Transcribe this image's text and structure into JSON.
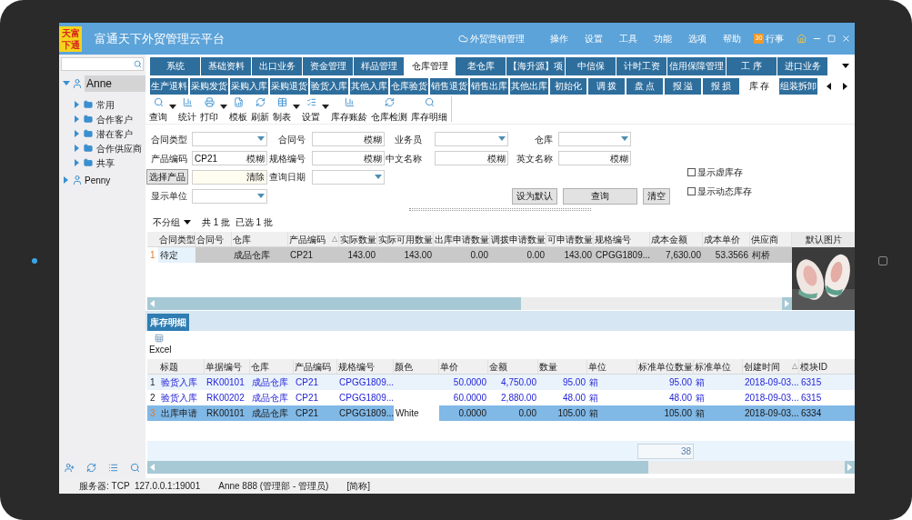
{
  "app": {
    "logo": [
      "天富",
      "下通"
    ],
    "title": "富通天下外贸管理云平台",
    "cloud_link": "外贸营销管理",
    "menu": [
      "操作",
      "设置",
      "工具",
      "功能",
      "选项",
      "帮助"
    ],
    "calendar": {
      "badge": "30",
      "label": "行事"
    }
  },
  "sidebar": {
    "tree": [
      {
        "label": "Anne",
        "expanded": true,
        "selected": true,
        "children": [
          {
            "label": "常用",
            "expanded": false
          },
          {
            "label": "合作客户",
            "expanded": false
          },
          {
            "label": "潜在客户",
            "expanded": false
          },
          {
            "label": "合作供应商",
            "expanded": false
          },
          {
            "label": "共享",
            "expanded": false
          }
        ]
      },
      {
        "label": "Penny",
        "expanded": false,
        "selected": false
      }
    ]
  },
  "module_tabs": [
    {
      "label": "系统",
      "selected": false
    },
    {
      "label": "基础资料",
      "selected": false
    },
    {
      "label": "出口业务",
      "selected": false
    },
    {
      "label": "资金管理",
      "selected": false
    },
    {
      "label": "样品管理",
      "selected": false
    },
    {
      "label": "仓库管理",
      "selected": true
    },
    {
      "label": "老仓库",
      "selected": false
    },
    {
      "label": "【海升源】项",
      "selected": false
    },
    {
      "label": "中信保",
      "selected": false
    },
    {
      "label": "计时工资",
      "selected": false
    },
    {
      "label": "信用保障管理",
      "selected": false
    },
    {
      "label": "工 序",
      "selected": false
    },
    {
      "label": "进口业务",
      "selected": false
    }
  ],
  "sub_tabs": [
    {
      "label": "生产退料",
      "selected": false
    },
    {
      "label": "采购发货",
      "selected": false
    },
    {
      "label": "采购入库",
      "selected": false
    },
    {
      "label": "采购退货",
      "selected": false
    },
    {
      "label": "验货入库",
      "selected": false
    },
    {
      "label": "其他入库",
      "selected": false
    },
    {
      "label": "仓库验货",
      "selected": false
    },
    {
      "label": "销售退货",
      "selected": false
    },
    {
      "label": "销售出库",
      "selected": false
    },
    {
      "label": "其他出库",
      "selected": false
    },
    {
      "label": "初始化",
      "selected": false
    },
    {
      "label": "调 拨",
      "selected": false
    },
    {
      "label": "盘 点",
      "selected": false
    },
    {
      "label": "报 溢",
      "selected": false
    },
    {
      "label": "报 损",
      "selected": false
    },
    {
      "label": "库 存",
      "selected": true
    },
    {
      "label": "组装拆卸",
      "selected": false
    }
  ],
  "toolbar": [
    {
      "label": "查询",
      "dropdown": true
    },
    {
      "label": "统计",
      "dropdown": false
    },
    {
      "label": "打印",
      "dropdown": true
    },
    {
      "label": "模板",
      "dropdown": false
    },
    {
      "label": "刷新",
      "dropdown": false
    },
    {
      "label": "制表",
      "dropdown": true
    },
    {
      "label": "设置",
      "dropdown": true
    },
    {
      "label": "库存账龄",
      "dropdown": false
    },
    {
      "label": "仓库检测",
      "dropdown": false
    },
    {
      "label": "库存明细",
      "dropdown": false
    }
  ],
  "filters": {
    "rows": [
      [
        {
          "kind": "select",
          "label": "合同类型"
        },
        {
          "kind": "text",
          "label": "合同号",
          "action": "模糊"
        },
        {
          "kind": "select",
          "label": "业务员"
        },
        {
          "kind": "select",
          "label": "仓库"
        }
      ],
      [
        {
          "kind": "text",
          "label": "产品编码",
          "value": "CP21",
          "action": "模糊"
        },
        {
          "kind": "text",
          "label": "规格编号",
          "action": "模糊"
        },
        {
          "kind": "text",
          "label": "中文名称",
          "action": "模糊"
        },
        {
          "kind": "text",
          "label": "英文名称",
          "action": "模糊"
        }
      ],
      [
        {
          "kind": "picker",
          "button": "选择产品",
          "action": "清除"
        },
        {
          "kind": "select",
          "label": "查询日期"
        }
      ],
      [
        {
          "kind": "select",
          "label": "显示单位"
        }
      ]
    ],
    "checkboxes": [
      {
        "label": "显示虚库存",
        "checked": false
      },
      {
        "label": "显示动态库存",
        "checked": false
      }
    ],
    "buttons": [
      "设为默认",
      "查询",
      "清空"
    ]
  },
  "stock_grid": {
    "group_by": "不分组",
    "summary": "共 1 批  已选 1 批",
    "image_column": "默认图片",
    "columns": [
      {
        "label": "合同类型"
      },
      {
        "label": "合同号"
      },
      {
        "label": "仓库"
      },
      {
        "label": "产品编码",
        "sort_mark": "△"
      },
      {
        "label": "实际数量",
        "numeric": true
      },
      {
        "label": "实际可用数量",
        "numeric": true
      },
      {
        "label": "出库申请数量",
        "numeric": true
      },
      {
        "label": "调拨申请数量",
        "numeric": true
      },
      {
        "label": "可申请数量",
        "numeric": true
      },
      {
        "label": "规格编号"
      },
      {
        "label": "成本金额",
        "numeric": true
      },
      {
        "label": "成本单价",
        "numeric": true
      },
      {
        "label": "供应商"
      }
    ],
    "rows": [
      {
        "number": "1",
        "selected": true,
        "cells": [
          {
            "text": "待定",
            "focused": true
          },
          null,
          "成品仓库",
          "CP21",
          "143.00",
          "143.00",
          "0.00",
          "0.00",
          "143.00",
          "CPGG1809...",
          "7,630.00",
          "53.3566",
          "柯桥"
        ]
      }
    ]
  },
  "detail_panel": {
    "tab": "库存明细",
    "export": "Excel",
    "columns": [
      {
        "label": "标题"
      },
      {
        "label": "单据编号"
      },
      {
        "label": "仓库"
      },
      {
        "label": "产品编码"
      },
      {
        "label": "规格编号"
      },
      {
        "label": "颜色"
      },
      {
        "label": "单价",
        "numeric": true
      },
      {
        "label": "金额",
        "numeric": true
      },
      {
        "label": "数量",
        "numeric": true
      },
      {
        "label": "单位"
      },
      {
        "label": "标准单位数量",
        "numeric": true,
        "total": "38"
      },
      {
        "label": "标准单位"
      },
      {
        "label": "创建时间",
        "sort_mark": "△"
      },
      {
        "label": "模块ID"
      }
    ],
    "rows": [
      {
        "number": "1",
        "selected": false,
        "cells": [
          "验货入库",
          "RK00101",
          "成品仓库",
          "CP21",
          "CPGG1809...",
          null,
          "50.0000",
          "4,750.00",
          "95.00",
          "箱",
          "95.00",
          "箱",
          "2018-09-03...",
          "6315"
        ]
      },
      {
        "number": "2",
        "selected": false,
        "cells": [
          "验货入库",
          "RK00202",
          "成品仓库",
          "CP21",
          "CPGG1809...",
          null,
          "60.0000",
          "2,880.00",
          "48.00",
          "箱",
          "48.00",
          "箱",
          "2018-09-03...",
          "6315"
        ]
      },
      {
        "number": "3",
        "selected": true,
        "cells": [
          "出库申请",
          "RK00101",
          "成品仓库",
          "CP21",
          "CPGG1809...",
          {
            "text": "White",
            "focused": true
          },
          "0.0000",
          "0.00",
          "105.00",
          "箱",
          "105.00",
          "箱",
          "2018-09-03...",
          "6334"
        ]
      }
    ]
  },
  "status_bar": [
    "服务器: TCP  127.0.0.1:19001",
    "Anne 888 (管理部 - 管理员)",
    "[简称]"
  ]
}
